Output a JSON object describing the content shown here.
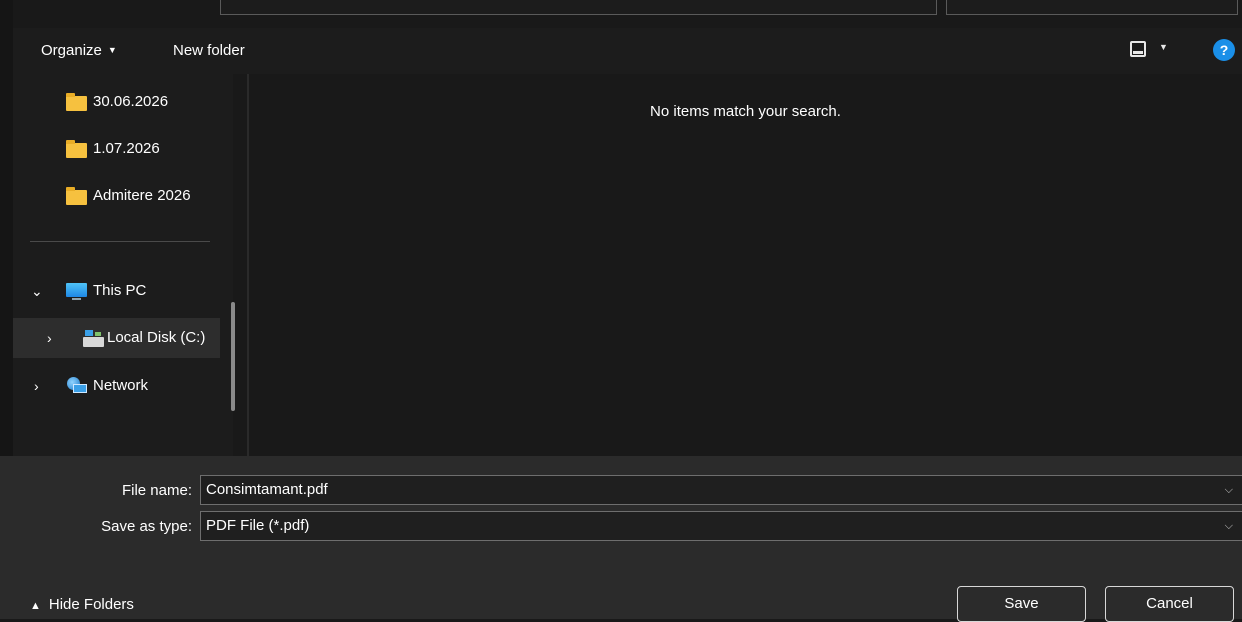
{
  "toolbar": {
    "organize_label": "Organize",
    "new_folder_label": "New folder",
    "view_icon": "view-options-icon",
    "help_label": "?"
  },
  "nav": {
    "folders": [
      {
        "label": "30.06.2026",
        "icon": "folder-icon"
      },
      {
        "label": "1.07.2026",
        "icon": "folder-icon"
      },
      {
        "label": "Admitere 2026",
        "icon": "folder-icon"
      }
    ],
    "this_pc": {
      "label": "This PC",
      "icon": "computer-icon",
      "expanded": true
    },
    "local_disk": {
      "label": "Local Disk (C:)",
      "icon": "drive-icon",
      "selected": true
    },
    "network": {
      "label": "Network",
      "icon": "network-icon"
    }
  },
  "content": {
    "empty_message": "No items match your search."
  },
  "form": {
    "file_name_label": "File name:",
    "file_name_value": "Consimtamant.pdf",
    "save_type_label": "Save as type:",
    "save_type_value": "PDF File (*.pdf)"
  },
  "footer": {
    "hide_folders_label": "Hide Folders",
    "save_label": "Save",
    "cancel_label": "Cancel"
  },
  "colors": {
    "background": "#191919",
    "bottom_panel": "#2b2b2b",
    "folder": "#f6c13f",
    "help_accent": "#1a8fe8"
  }
}
